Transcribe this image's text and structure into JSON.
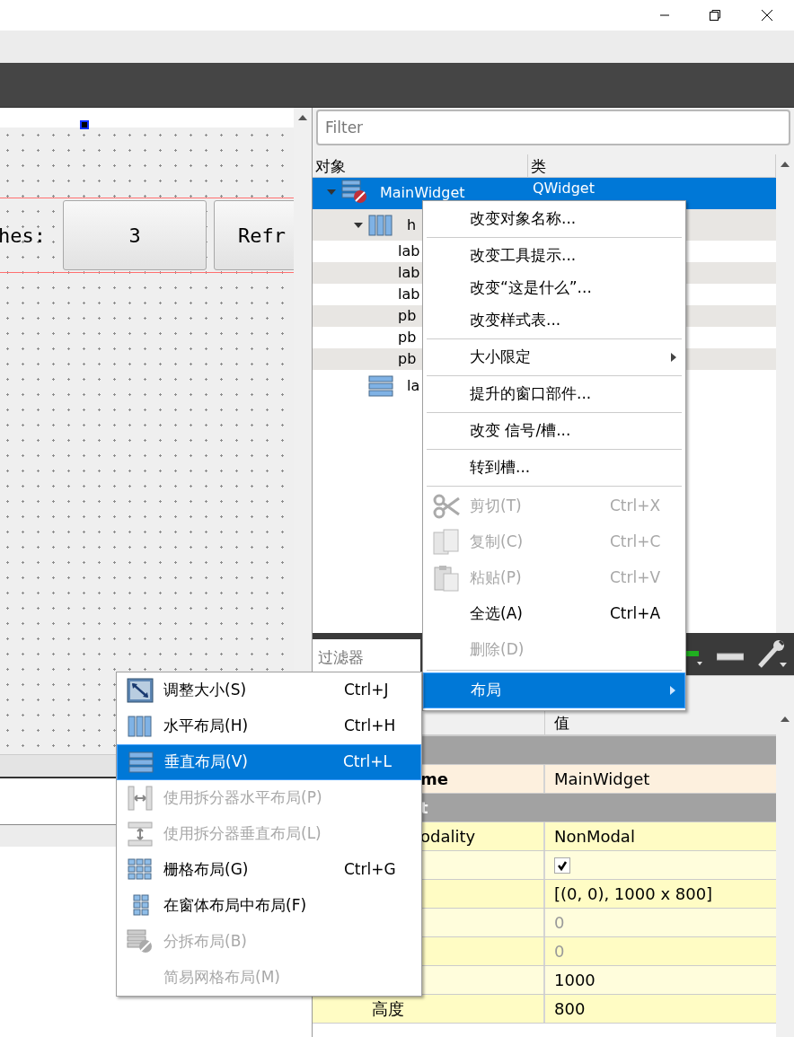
{
  "canvas": {
    "label": "hes:",
    "buttons": [
      "3",
      "Refr"
    ]
  },
  "object_inspector": {
    "filter_placeholder": "Filter",
    "columns": [
      "对象",
      "类"
    ],
    "objects": [
      {
        "name": "MainWidget",
        "class": "QWidget",
        "kind": "broken",
        "selected": true,
        "expanded": true,
        "children": [
          {
            "name": "h",
            "kind": "hbox",
            "selected": false,
            "expanded": true,
            "children": [
              {
                "name": "lab",
                "kind": "leaf",
                "selected": false
              },
              {
                "name": "lab",
                "kind": "leaf",
                "selected": false
              },
              {
                "name": "lab",
                "kind": "leaf",
                "selected": false
              },
              {
                "name": "pb",
                "kind": "leaf",
                "selected": false
              },
              {
                "name": "pb",
                "kind": "leaf",
                "selected": false
              },
              {
                "name": "pb",
                "kind": "leaf",
                "selected": false
              }
            ]
          },
          {
            "name": "la",
            "kind": "vbox",
            "selected": false
          }
        ]
      }
    ]
  },
  "property_editor": {
    "filter_placeholder": "过滤器",
    "value_header": "值",
    "rows": [
      {
        "kind": "section"
      },
      {
        "kind": "name",
        "name": "me",
        "value": "MainWidget",
        "disabled": false
      },
      {
        "kind": "section",
        "name": "t"
      },
      {
        "kind": "property",
        "name": "odality",
        "value": "NonModal",
        "disabled": false
      },
      {
        "kind": "check",
        "checked": true
      },
      {
        "kind": "property",
        "value": "[(0, 0), 1000 x 800]",
        "disabled": false
      },
      {
        "kind": "sub",
        "value": "0",
        "disabled": true
      },
      {
        "kind": "sub",
        "value": "0",
        "disabled": true
      },
      {
        "kind": "sub",
        "value": "1000",
        "disabled": false
      },
      {
        "kind": "sub",
        "name": "高度",
        "value": "800",
        "disabled": false
      }
    ]
  },
  "context_menu": [
    {
      "kind": "item",
      "label": "改变对象名称...",
      "disabled": false
    },
    {
      "kind": "separator"
    },
    {
      "kind": "item",
      "label": "改变工具提示...",
      "disabled": false
    },
    {
      "kind": "item",
      "label": "改变“这是什么”...",
      "disabled": false
    },
    {
      "kind": "item",
      "label": "改变样式表...",
      "disabled": false
    },
    {
      "kind": "separator"
    },
    {
      "kind": "submenu",
      "label": "大小限定",
      "disabled": false,
      "selected": false
    },
    {
      "kind": "separator"
    },
    {
      "kind": "item",
      "label": "提升的窗口部件...",
      "disabled": false
    },
    {
      "kind": "separator"
    },
    {
      "kind": "item",
      "label": "改变 信号/槽...",
      "disabled": false
    },
    {
      "kind": "separator"
    },
    {
      "kind": "item",
      "label": "转到槽...",
      "disabled": false
    },
    {
      "kind": "separator"
    },
    {
      "kind": "item",
      "label": "剪切(T)",
      "shortcut": "Ctrl+X",
      "disabled": true
    },
    {
      "kind": "item",
      "label": "复制(C)",
      "shortcut": "Ctrl+C",
      "disabled": true
    },
    {
      "kind": "item",
      "label": "粘贴(P)",
      "shortcut": "Ctrl+V",
      "disabled": true
    },
    {
      "kind": "item",
      "label": "全选(A)",
      "shortcut": "Ctrl+A",
      "disabled": false
    },
    {
      "kind": "item",
      "label": "删除(D)",
      "disabled": true
    },
    {
      "kind": "separator"
    },
    {
      "kind": "submenu",
      "label": "布局",
      "disabled": false,
      "selected": true
    }
  ],
  "layout_menu": [
    {
      "label": "调整大小(S)",
      "shortcut": "Ctrl+J",
      "disabled": false,
      "selected": false
    },
    {
      "label": "水平布局(H)",
      "shortcut": "Ctrl+H",
      "disabled": false,
      "selected": false
    },
    {
      "label": "垂直布局(V)",
      "shortcut": "Ctrl+L",
      "disabled": false,
      "selected": true
    },
    {
      "label": "使用拆分器水平布局(P)",
      "disabled": true,
      "selected": false
    },
    {
      "label": "使用拆分器垂直布局(L)",
      "disabled": true,
      "selected": false
    },
    {
      "label": "栅格布局(G)",
      "shortcut": "Ctrl+G",
      "disabled": false,
      "selected": false
    },
    {
      "label": "在窗体布局中布局(F)",
      "disabled": false,
      "selected": false
    },
    {
      "label": "分拆布局(B)",
      "disabled": true,
      "selected": false
    },
    {
      "label": "简易网格布局(M)",
      "disabled": true,
      "selected": false
    }
  ]
}
